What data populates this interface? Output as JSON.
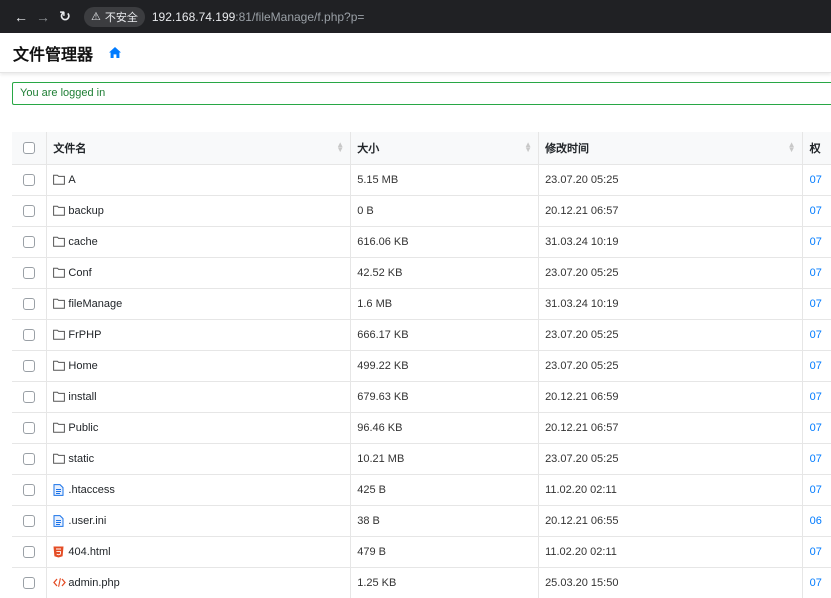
{
  "browser": {
    "insecure_label": "不安全",
    "url_host": "192.168.74.199",
    "url_rest": ":81/fileManage/f.php?p="
  },
  "app": {
    "brand": "文件管理器"
  },
  "alert": {
    "text": "You are logged in"
  },
  "table": {
    "headers": {
      "name": "文件名",
      "size": "大小",
      "modified": "修改时间",
      "perms": "权"
    },
    "rows": [
      {
        "type": "folder",
        "icon": "folder-icon",
        "name": "A",
        "size": "5.15 MB",
        "modified": "23.07.20 05:25",
        "perms": "07"
      },
      {
        "type": "folder",
        "icon": "folder-icon",
        "name": "backup",
        "size": "0 B",
        "modified": "20.12.21 06:57",
        "perms": "07"
      },
      {
        "type": "folder",
        "icon": "folder-icon",
        "name": "cache",
        "size": "616.06 KB",
        "modified": "31.03.24 10:19",
        "perms": "07"
      },
      {
        "type": "folder",
        "icon": "folder-icon",
        "name": "Conf",
        "size": "42.52 KB",
        "modified": "23.07.20 05:25",
        "perms": "07"
      },
      {
        "type": "folder",
        "icon": "folder-icon",
        "name": "fileManage",
        "size": "1.6 MB",
        "modified": "31.03.24 10:19",
        "perms": "07"
      },
      {
        "type": "folder",
        "icon": "folder-icon",
        "name": "FrPHP",
        "size": "666.17 KB",
        "modified": "23.07.20 05:25",
        "perms": "07"
      },
      {
        "type": "folder",
        "icon": "folder-icon",
        "name": "Home",
        "size": "499.22 KB",
        "modified": "23.07.20 05:25",
        "perms": "07"
      },
      {
        "type": "folder",
        "icon": "folder-icon",
        "name": "install",
        "size": "679.63 KB",
        "modified": "20.12.21 06:59",
        "perms": "07"
      },
      {
        "type": "folder",
        "icon": "folder-icon",
        "name": "Public",
        "size": "96.46 KB",
        "modified": "20.12.21 06:57",
        "perms": "07"
      },
      {
        "type": "folder",
        "icon": "folder-icon",
        "name": "static",
        "size": "10.21 MB",
        "modified": "23.07.20 05:25",
        "perms": "07"
      },
      {
        "type": "file",
        "icon": "text-file-icon",
        "name": ".htaccess",
        "size": "425 B",
        "modified": "11.02.20 02:11",
        "perms": "07"
      },
      {
        "type": "file",
        "icon": "text-file-icon",
        "name": ".user.ini",
        "size": "38 B",
        "modified": "20.12.21 06:55",
        "perms": "06"
      },
      {
        "type": "file",
        "icon": "html5-icon",
        "name": "404.html",
        "size": "479 B",
        "modified": "11.02.20 02:11",
        "perms": "07"
      },
      {
        "type": "file",
        "icon": "code-icon",
        "name": "admin.php",
        "size": "1.25 KB",
        "modified": "25.03.20 15:50",
        "perms": "07"
      }
    ]
  },
  "colors": {
    "chrome_bg": "#202124",
    "alert_border": "#28a745",
    "link": "#007bff",
    "home_icon": "#007bff",
    "html_icon": "#e44d26",
    "code_icon": "#e44d26",
    "text_file_icon": "#1a73e8"
  }
}
